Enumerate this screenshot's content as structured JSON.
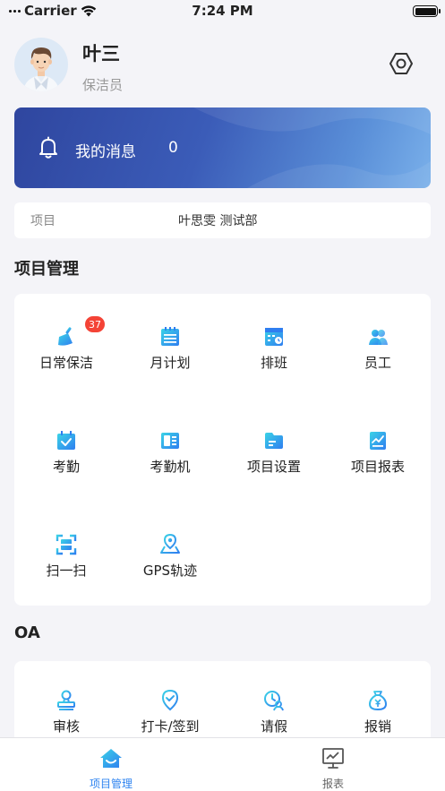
{
  "status_bar": {
    "carrier": "Carrier",
    "time": "7:24 PM"
  },
  "profile": {
    "name": "叶三",
    "role": "保洁员"
  },
  "messages": {
    "label": "我的消息",
    "count": "0"
  },
  "project": {
    "label": "项目",
    "value": "叶思雯 测试部"
  },
  "project_management": {
    "title": "项目管理",
    "items": [
      {
        "label": "日常保洁",
        "icon": "broom-icon",
        "badge": "37"
      },
      {
        "label": "月计划",
        "icon": "calendar-list-icon"
      },
      {
        "label": "排班",
        "icon": "schedule-icon"
      },
      {
        "label": "员工",
        "icon": "staff-icon"
      },
      {
        "label": "考勤",
        "icon": "attendance-check-icon"
      },
      {
        "label": "考勤机",
        "icon": "time-clock-icon"
      },
      {
        "label": "项目设置",
        "icon": "folder-icon"
      },
      {
        "label": "项目报表",
        "icon": "report-chart-icon"
      },
      {
        "label": "扫一扫",
        "icon": "scan-icon"
      },
      {
        "label": "GPS轨迹",
        "icon": "gps-location-icon"
      }
    ]
  },
  "oa": {
    "title": "OA",
    "items": [
      {
        "label": "审核",
        "icon": "stamp-icon"
      },
      {
        "label": "打卡/签到",
        "icon": "check-in-icon"
      },
      {
        "label": "请假",
        "icon": "leave-clock-icon"
      },
      {
        "label": "报销",
        "icon": "money-bag-icon"
      }
    ]
  },
  "tabbar": {
    "items": [
      {
        "label": "项目管理",
        "icon": "home-icon",
        "active": true
      },
      {
        "label": "报表",
        "icon": "chart-monitor-icon",
        "active": false
      }
    ]
  },
  "colors": {
    "accent": "#2f84f0",
    "icon_start": "#3bd3e6",
    "icon_end": "#2f7ef0",
    "badge": "#f44336"
  }
}
